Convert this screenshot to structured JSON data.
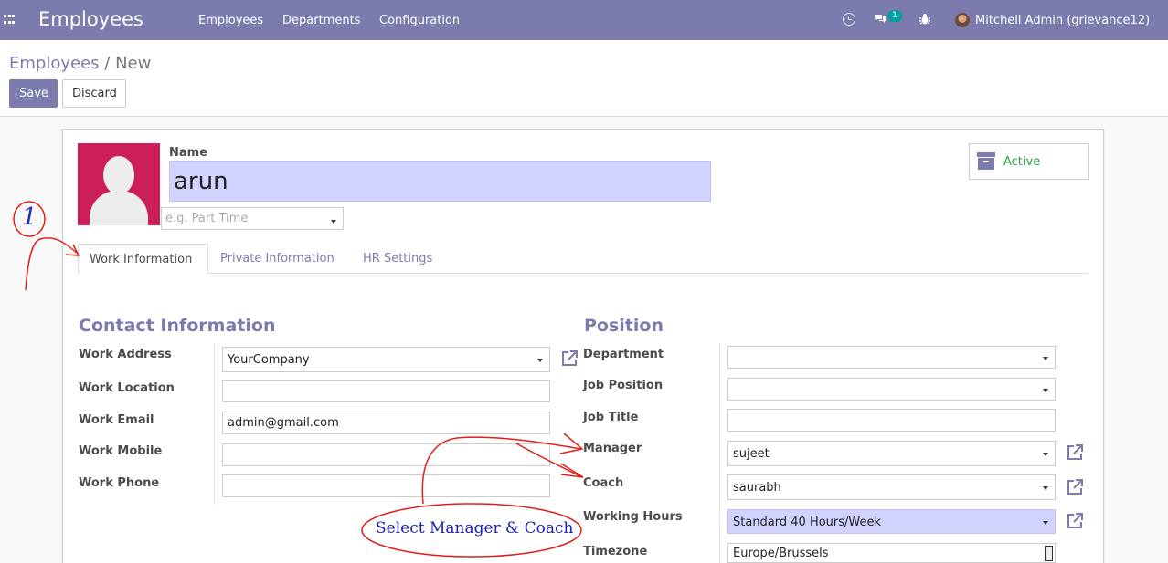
{
  "navbar": {
    "brand": "Employees",
    "menu": [
      "Employees",
      "Departments",
      "Configuration"
    ],
    "chat_badge": "1",
    "user": "Mitchell Admin (grievance12)",
    "icons": [
      "apps-icon",
      "clock-icon",
      "chat-icon",
      "bug-icon",
      "avatar"
    ]
  },
  "control": {
    "breadcrumb_parent": "Employees",
    "breadcrumb_sep": "/",
    "breadcrumb_current": "New",
    "save_label": "Save",
    "discard_label": "Discard"
  },
  "form": {
    "name_label": "Name",
    "name_value": "arun",
    "tag_placeholder": "e.g. Part Time",
    "active_label": "Active",
    "tabs": [
      "Work Information",
      "Private Information",
      "HR Settings"
    ],
    "contact_title": "Contact Information",
    "position_title": "Position",
    "contact_fields": [
      {
        "label": "Work Address",
        "value": "YourCompany"
      },
      {
        "label": "Work Location",
        "value": ""
      },
      {
        "label": "Work Email",
        "value": "admin@gmail.com"
      },
      {
        "label": "Work Mobile",
        "value": ""
      },
      {
        "label": "Work Phone",
        "value": ""
      }
    ],
    "position_fields": [
      {
        "label": "Department",
        "value": ""
      },
      {
        "label": "Job Position",
        "value": ""
      },
      {
        "label": "Job Title",
        "value": ""
      },
      {
        "label": "Manager",
        "value": "sujeet"
      },
      {
        "label": "Coach",
        "value": "saurabh"
      },
      {
        "label": "Working Hours",
        "value": "Standard 40 Hours/Week"
      },
      {
        "label": "Timezone",
        "value": "Europe/Brussels"
      }
    ]
  },
  "annotations": {
    "step_number": "1",
    "note": "Select Manager & Coach"
  },
  "colors": {
    "brand": "#7c7bad",
    "highlight_input": "#d2d2ff",
    "active_green": "#28a745",
    "annotation_red": "#e0201b",
    "annotation_blue": "#1a20b8"
  }
}
